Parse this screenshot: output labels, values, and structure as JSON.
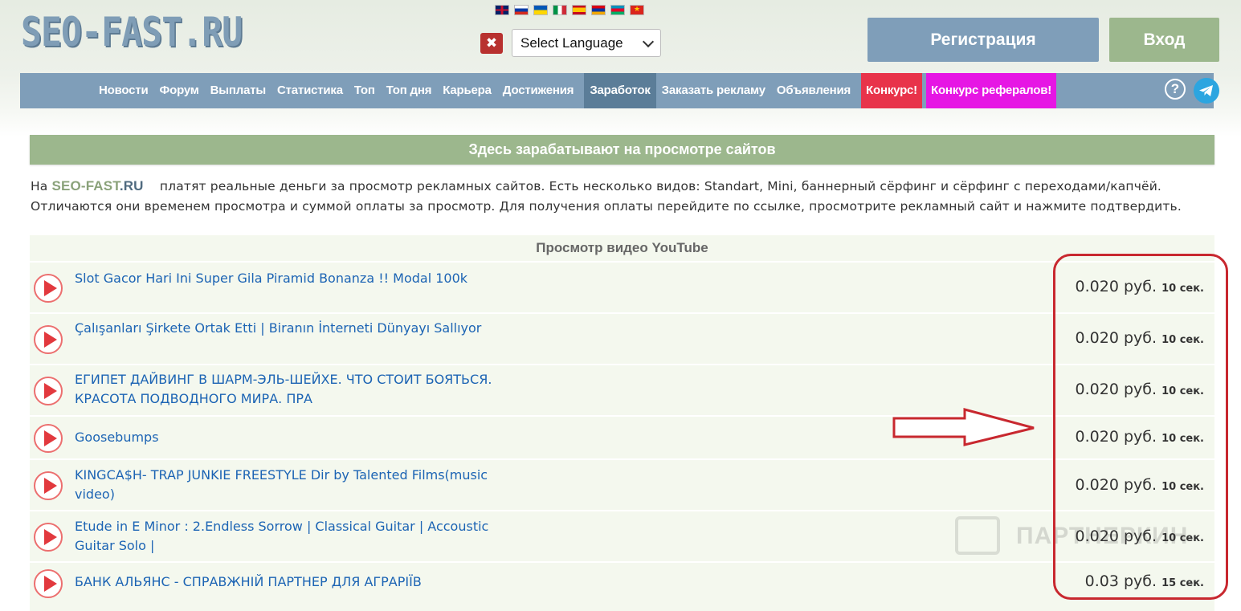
{
  "header": {
    "logo_text": "SEO-FAST",
    "logo_suffix": ".RU",
    "flags": [
      "gb",
      "ru",
      "ua",
      "it",
      "es",
      "am",
      "az",
      "vn"
    ],
    "close_icon": "✖",
    "language_select": "Select Language",
    "register_label": "Регистрация",
    "login_label": "Вход"
  },
  "nav": {
    "items": [
      "Новости",
      "Форум",
      "Выплаты",
      "Статистика",
      "Топ",
      "Топ дня",
      "Карьера",
      "Достижения"
    ],
    "active": "Заработок",
    "order_ad": "Заказать рекламу",
    "ads": "Объявления",
    "contest": "Конкурс!",
    "ref_contest": "Конкурс рефералов!",
    "help_icon": "?"
  },
  "banner": "Здесь зарабатывают на просмотре сайтов",
  "intro": {
    "prefix": "На ",
    "site": "SEO-FAST",
    "site_suffix": ".RU",
    "text": "    платят реальные деньги за просмотр рекламных сайтов. Есть несколько видов: Standart, Mini, баннерный сёрфинг и сёрфинг с переходами/капчёй. Отличаются они временем просмотра и суммой оплаты за просмотр. Для получения оплаты перейдите по ссылке, просмотрите рекламный сайт и нажмите подтвердить."
  },
  "table": {
    "heading": "Просмотр видео YouTube",
    "rows": [
      {
        "title": "Slot Gacor Hari Ini Super Gila Piramid Bonanza !! Modal 100k",
        "price": "0.020 руб.",
        "time": "10 сек."
      },
      {
        "title": "Çalışanları Şirkete Ortak Etti | Biranın İnterneti Dünyayı Sallıyor",
        "price": "0.020 руб.",
        "time": "10 сек."
      },
      {
        "title": "ЕГИПЕТ ДАЙВИНГ В ШАРМ-ЭЛЬ-ШЕЙХЕ. ЧТО СТОИТ БОЯТЬСЯ. КРАСОТА ПОДВОДНОГО МИРА. ПРА",
        "price": "0.020 руб.",
        "time": "10 сек."
      },
      {
        "title": "Goosebumps",
        "price": "0.020 руб.",
        "time": "10 сек."
      },
      {
        "title": "KINGCA$H- TRAP JUNKIE FREESTYLE Dir by Talented Films(music video)",
        "price": "0.020 руб.",
        "time": "10 сек."
      },
      {
        "title": "Etude in E Minor : 2.Endless Sorrow | Classical Guitar | Accoustic Guitar Solo |",
        "price": "0.020 руб.",
        "time": "10 сек."
      },
      {
        "title": "БАНК АЛЬЯНС - СПРАВЖНІЙ ПАРТНЕР ДЛЯ АГРАРІЇВ",
        "price": "0.03 руб.",
        "time": "15 сек."
      }
    ]
  },
  "watermark": "ПАРТНЕРКИН",
  "colors": {
    "nav_bg": "#7f9eb9",
    "accent_green": "#9cb78d",
    "link_blue": "#1c64b4",
    "highlight_red": "#c8282f",
    "contest_red": "#e8334a",
    "contest_magenta": "#e616e4"
  }
}
